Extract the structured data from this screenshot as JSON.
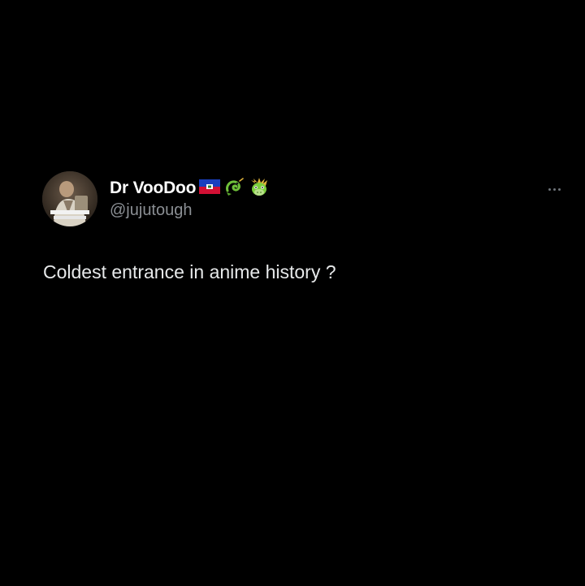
{
  "tweet": {
    "author": {
      "display_name": "Dr VooDoo",
      "handle": "@jujutough",
      "name_emojis": [
        "haiti-flag-icon",
        "dragon-icon",
        "dragon-face-icon"
      ]
    },
    "text": "Coldest entrance in anime history ?",
    "more_icon": "more-horizontal-icon"
  },
  "colors": {
    "background": "#000000",
    "name": "#ffffff",
    "handle": "#8b8f94",
    "text": "#e7e9ea"
  }
}
